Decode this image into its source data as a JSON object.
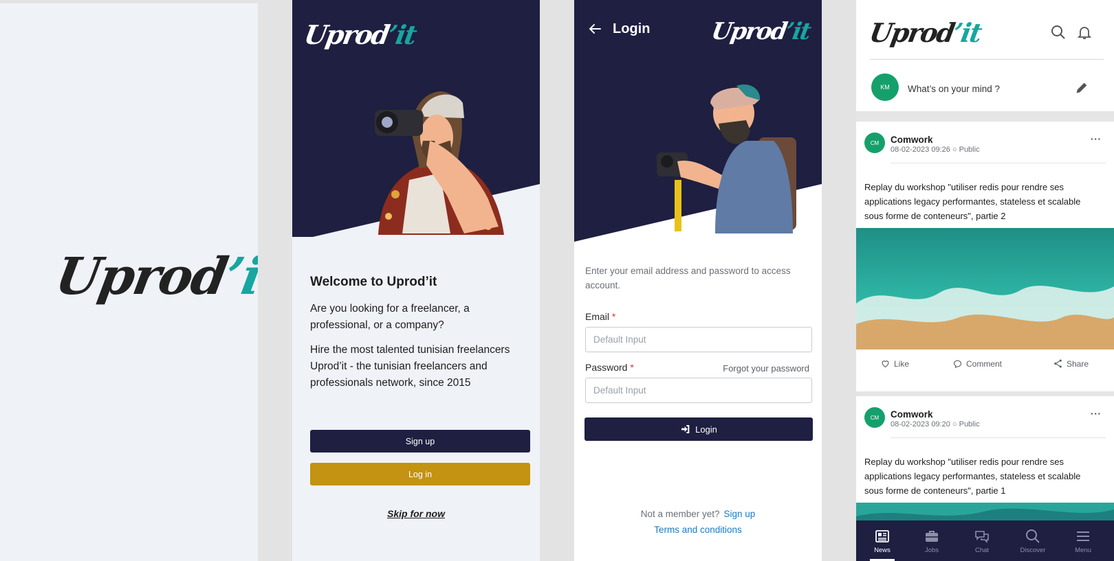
{
  "brand": {
    "name_main": "Uprod",
    "name_accent": "’it"
  },
  "colors": {
    "navy": "#1e1f41",
    "gold": "#c39311",
    "teal": "#17a6a0",
    "avatar_green": "#15a06b",
    "link_blue": "#1a7bc4"
  },
  "welcome": {
    "title": "Welcome to Uprod’it",
    "para1": "Are you looking for a freelancer, a professional, or a company?",
    "para2": "Hire the most talented tunisian freelancers Uprod’it - the tunisian freelancers and professionals network, since 2015",
    "signup_label": "Sign up",
    "login_label": "Log in",
    "skip_label": "Skip for now"
  },
  "login": {
    "title": "Login",
    "intro": "Enter your email address and password to access account.",
    "email_label": "Email",
    "email_placeholder": "Default Input",
    "password_label": "Password",
    "password_placeholder": "Default Input",
    "required_mark": "*",
    "forgot_label": "Forgot your password",
    "button_label": "Login",
    "not_member": "Not a member yet?",
    "signup_link": "Sign up",
    "terms_link": "Terms and conditions"
  },
  "feed": {
    "my_initials": "KM",
    "composer_placeholder": "What’s on your mind ?",
    "posts": [
      {
        "initials": "CM",
        "author": "Comwork",
        "meta": "08-02-2023 09:26 ○ Public",
        "body": "Replay du workshop \"utiliser redis pour rendre ses applications legacy performantes, stateless et scalable sous forme de conteneurs\", partie 2",
        "more": "···"
      },
      {
        "initials": "CM",
        "author": "Comwork",
        "meta": "08-02-2023 09:20 ○ Public",
        "body": "Replay du workshop \"utiliser redis pour rendre ses applications legacy performantes, stateless et scalable sous forme de conteneurs\", partie 1",
        "more": "···"
      }
    ],
    "actions": {
      "like": "Like",
      "comment": "Comment",
      "share": "Share"
    },
    "nav": [
      {
        "label": "News",
        "icon": "news-icon"
      },
      {
        "label": "Jobs",
        "icon": "briefcase-icon"
      },
      {
        "label": "Chat",
        "icon": "chat-icon"
      },
      {
        "label": "Discover",
        "icon": "search-icon"
      },
      {
        "label": "Menu",
        "icon": "menu-icon"
      }
    ]
  }
}
